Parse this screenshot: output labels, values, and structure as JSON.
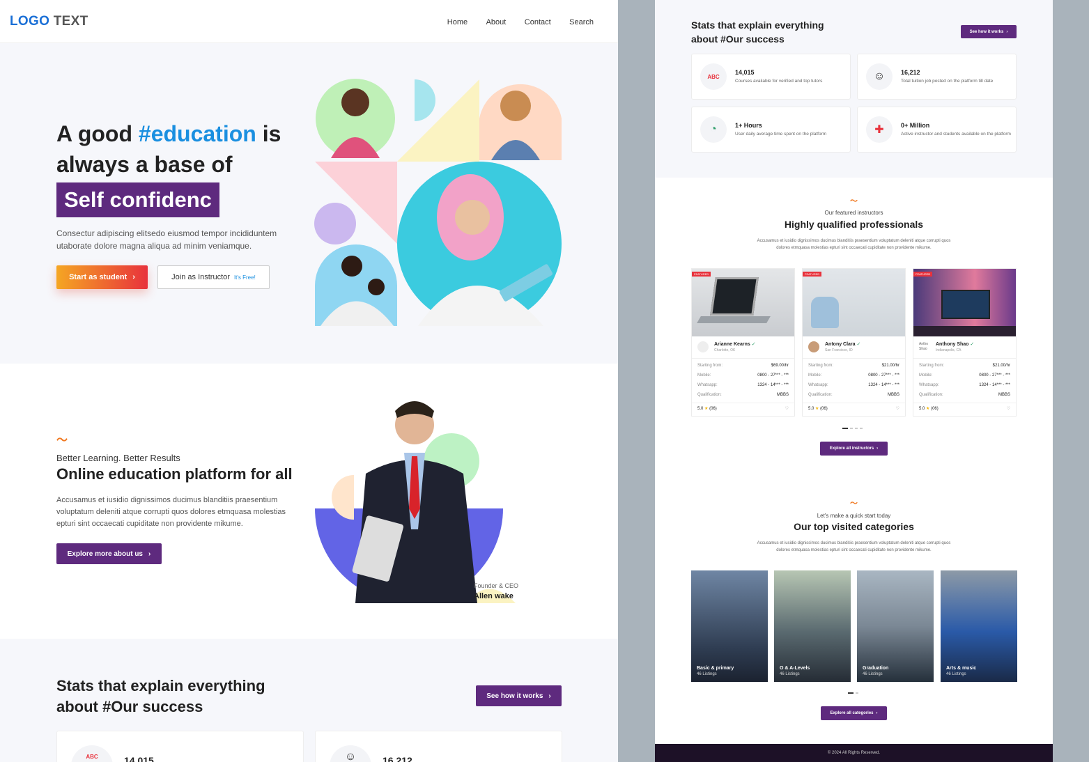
{
  "header": {
    "logo_a": "LOGO",
    "logo_b": " TEXT",
    "nav": [
      "Home",
      "About",
      "Contact",
      "Search"
    ]
  },
  "hero": {
    "title_a": "A good ",
    "title_hl": "#education",
    "title_b": " is always a base of",
    "badge": "Self confidenc",
    "text": "Consectur adipiscing elitsedo eiusmod tempor incididuntem utaborate dolore magna aliqua ad minim veniamque.",
    "btn_student": "Start as student",
    "btn_instructor": "Join as Instructor",
    "btn_instructor_note": "It's Free!"
  },
  "about": {
    "tag": "Better Learning. Better Results",
    "title": "Online education platform for all",
    "text": "Accusamus et iusidio dignissimos ducimus blanditiis praesentium voluptatum deleniti atque corrupti quos dolores etmquasa molestias epturi sint occaecati cupiditate non providente mikume.",
    "btn": "Explore more about us",
    "ceo_role": "Founder & CEO",
    "ceo_name": "Allen wake"
  },
  "stats": {
    "title": "Stats that explain everything about #Our success",
    "title_l1": "Stats that explain everything",
    "title_l2": "about #Our success",
    "btn": "See how it works",
    "items": [
      {
        "num": "14,015",
        "label": "Courses available for verified and top tutors",
        "icon": "abc-board-icon"
      },
      {
        "num": "16,212",
        "label": "Total tuition job posted on the platform till date",
        "icon": "kids-icon"
      },
      {
        "num": "1+ Hours",
        "label": "User daily average time spent on the platform",
        "icon": "clock-icon"
      },
      {
        "num": "0+ Million",
        "label": "Active instructor and students available on the platform",
        "icon": "people-icon"
      }
    ]
  },
  "instructors": {
    "tag": "Our featured instructors",
    "title": "Highly qualified professionals",
    "text": "Accusamus et iusidio dignissimos ducimus blanditiis praesentium voluptatum deleniti atque corrupti quos dolores etmquasa molestias epturi sint occaecati cupiditate non providente mikume.",
    "featured": "FEATURED",
    "btn": "Explore all instructors",
    "labels": {
      "start": "Starting from:",
      "mobile": "Mobile:",
      "whatsapp": "Whatsapp:",
      "qual": "Qualification:"
    },
    "items": [
      {
        "name": "Arianne Kearns",
        "loc": "Charlotte, OK",
        "rate": "$69.00/hr",
        "mobile": "0800 - 27*** - ***",
        "whatsapp": "1324 - 14*** - ***",
        "qual": "MBBS",
        "rating": "5.0",
        "reviews": "(06)"
      },
      {
        "name": "Antony Clara",
        "loc": "San Francisco, ID",
        "rate": "$21.00/hr",
        "mobile": "0800 - 27*** - ***",
        "whatsapp": "1324 - 14*** - ***",
        "qual": "MBBS",
        "rating": "5.0",
        "reviews": "(06)"
      },
      {
        "name": "Anthony Shao",
        "loc": "Indianapolis, CA",
        "rate": "$21.00/hr",
        "mobile": "0800 - 27*** - ***",
        "whatsapp": "1324 - 14*** - ***",
        "qual": "MBBS",
        "rating": "5.0",
        "reviews": "(06)",
        "avatar_alt": "Antho Shao"
      }
    ]
  },
  "categories": {
    "tag": "Let's make a quick start today",
    "title": "Our top visited categories",
    "text": "Accusamus et iusidio dignissimos ducimus blanditiis praesentium voluptatum deleniti atque corrupti quos dolores etmquasa molestias epturi sint occaecati cupiditate non providente mikume.",
    "btn": "Explore all categories",
    "items": [
      {
        "name": "Basic & primary",
        "count": "46 Listings"
      },
      {
        "name": "O & A-Levels",
        "count": "46 Listings"
      },
      {
        "name": "Graduation",
        "count": "46 Listings"
      },
      {
        "name": "Arts & music",
        "count": "46 Listings"
      }
    ]
  },
  "footer": {
    "text": "© 2024 All Rights Reserved."
  }
}
